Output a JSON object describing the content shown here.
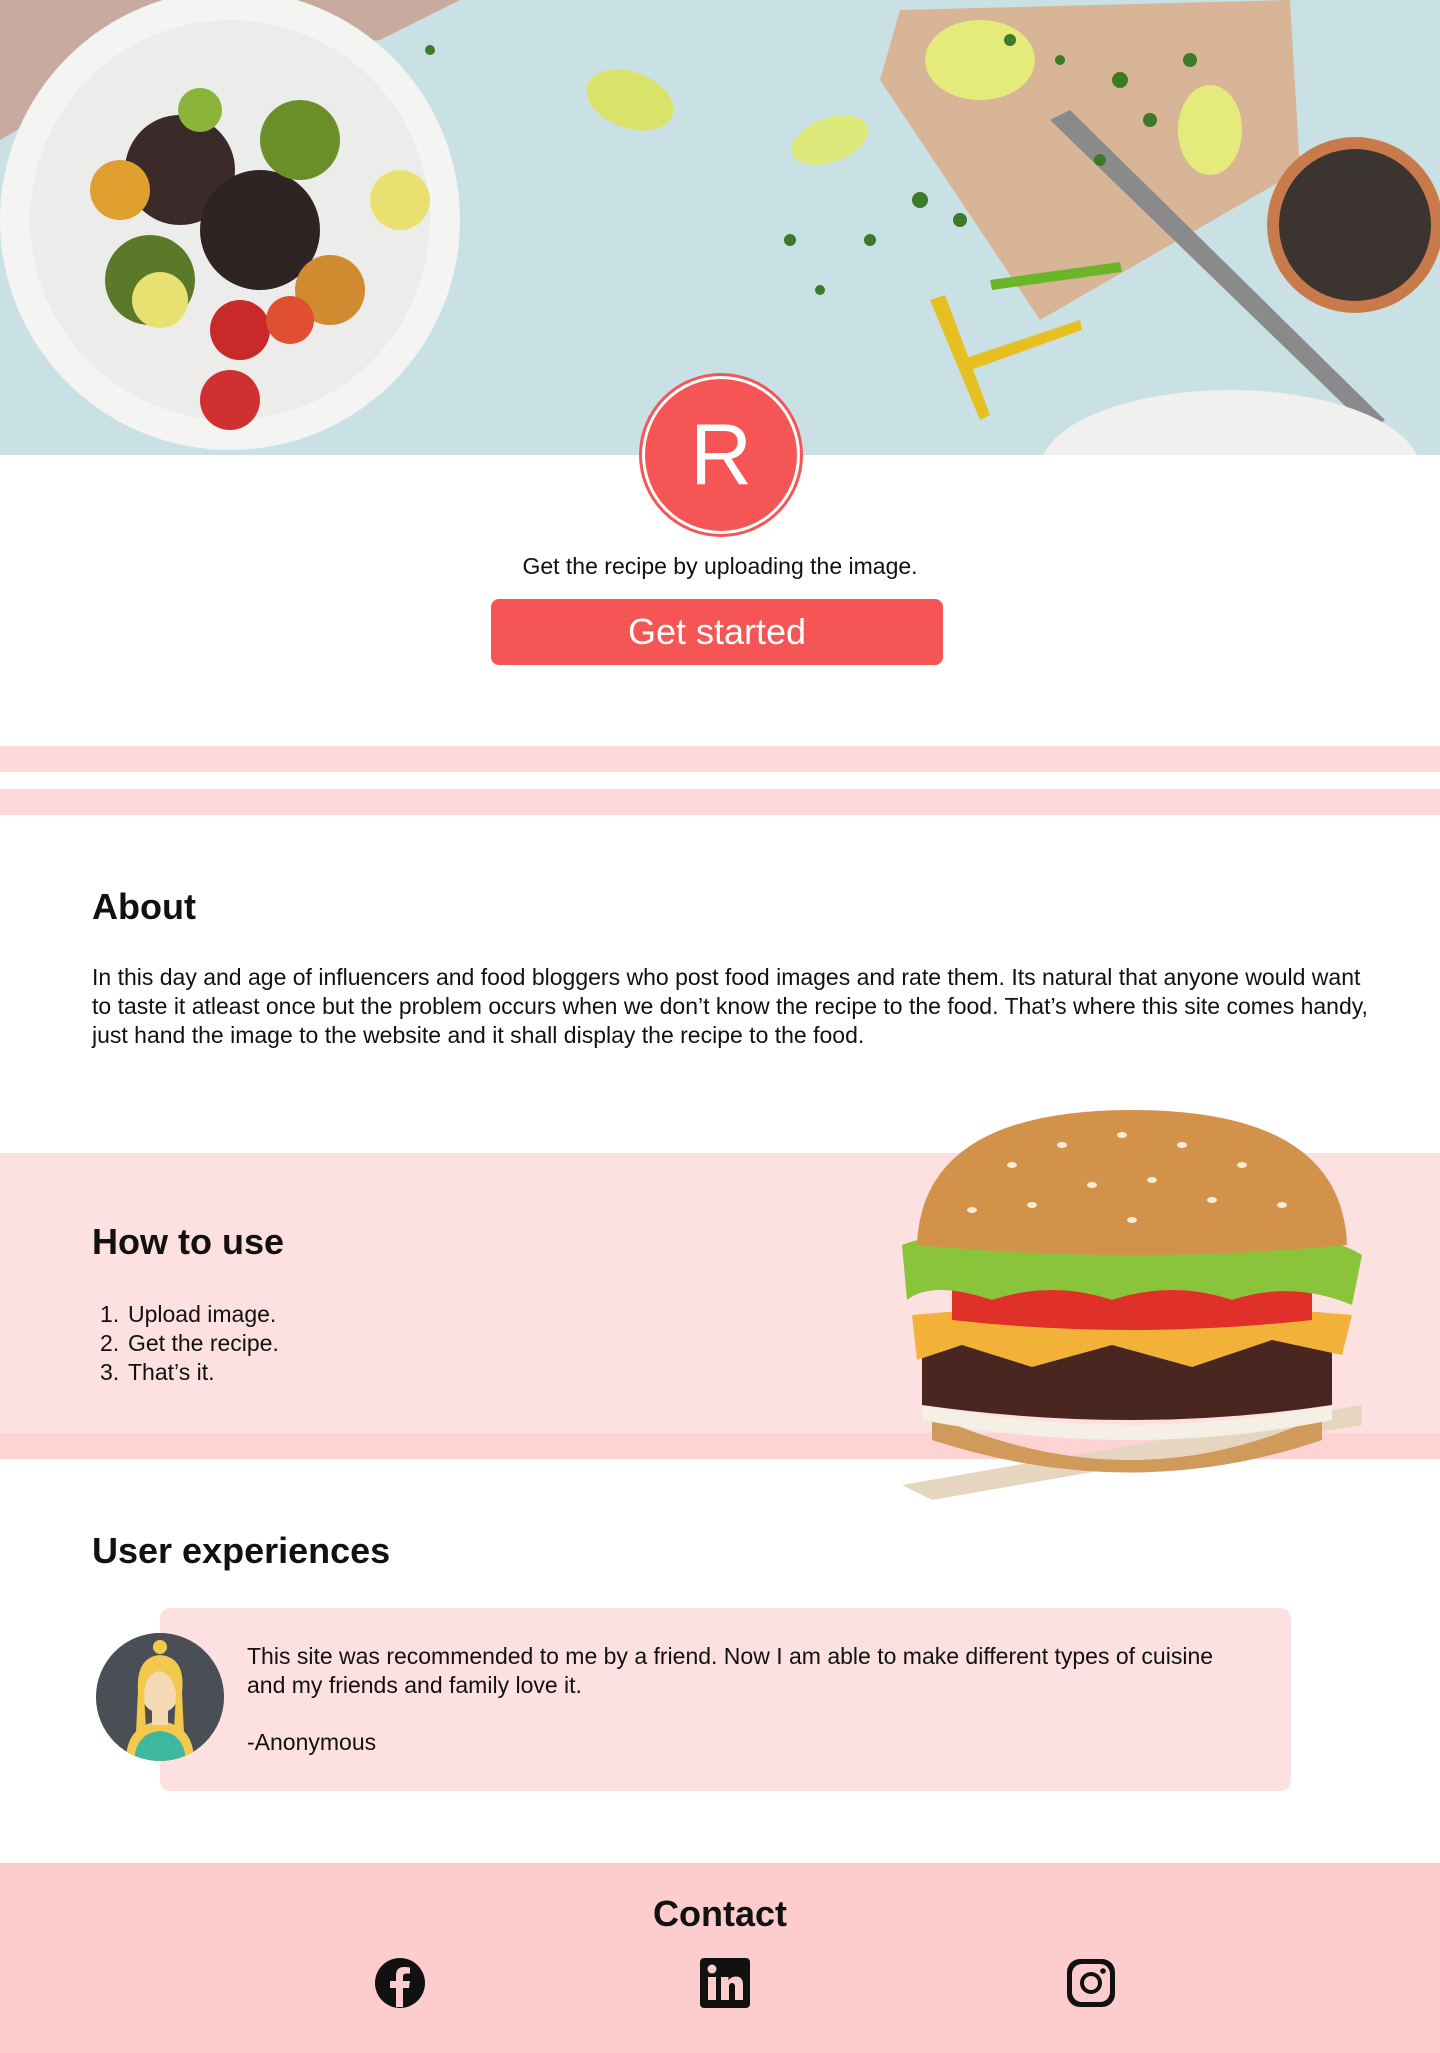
{
  "brand": {
    "logo_letter": "R"
  },
  "hero": {
    "tagline": "Get the recipe by uploading the image.",
    "cta_label": "Get started"
  },
  "about": {
    "title": "About",
    "text": "In this day and age of influencers and food bloggers who post food images and rate them. Its natural that anyone would want to taste it atleast once but the problem occurs when we don’t know the recipe to the food. That’s where this site comes handy, just hand the image to the website and it shall display the recipe to the food."
  },
  "howto": {
    "title": "How to use",
    "steps": [
      {
        "num": "1.",
        "text": "Upload image."
      },
      {
        "num": "2.",
        "text": "Get the recipe."
      },
      {
        "num": "3.",
        "text": "That’s it."
      }
    ]
  },
  "experiences": {
    "title": "User experiences",
    "quote": "This site was recommended to me by a friend. Now I am able to make different types of cuisine and my friends and family love it.",
    "author": "-Anonymous"
  },
  "contact": {
    "title": "Contact",
    "icons": [
      "facebook-icon",
      "linkedin-icon",
      "instagram-icon"
    ]
  },
  "colors": {
    "accent": "#f55555",
    "pink_light": "#fde1e1",
    "pink_stripe": "#fdd9d9",
    "footer": "#fdcccc"
  }
}
